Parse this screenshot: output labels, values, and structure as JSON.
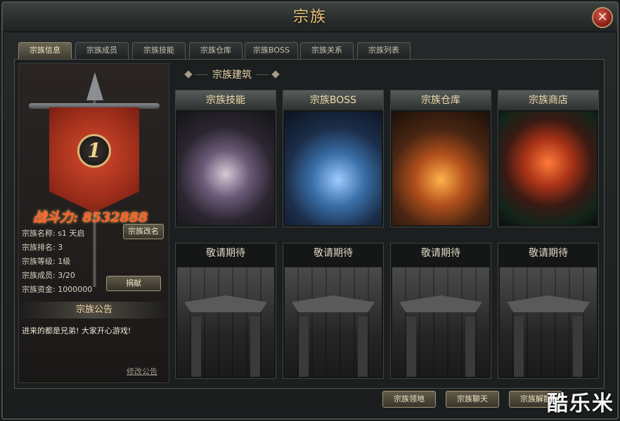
{
  "window": {
    "title": "宗族",
    "close_symbol": "✕"
  },
  "tabs": [
    {
      "label": "宗族信息",
      "active": true
    },
    {
      "label": "宗族成员"
    },
    {
      "label": "宗族技能"
    },
    {
      "label": "宗族仓库"
    },
    {
      "label": "宗族BOSS"
    },
    {
      "label": "宗族关系"
    },
    {
      "label": "宗族列表"
    }
  ],
  "clan": {
    "rank_number": "1",
    "power": "战斗力: 8532888",
    "name": "宗族名称: s1 天启",
    "rank": "宗族排名: 3",
    "level": "宗族等级: 1级",
    "members": "宗族成员: 3/20",
    "funds": "宗族资金: 1000000",
    "rename_button": "宗族改名",
    "donate_button": "捐献"
  },
  "notice": {
    "title": "宗族公告",
    "text": "进来的都是兄弟! 大家开心游戏!",
    "edit_link": "修改公告"
  },
  "buildings": {
    "header": "宗族建筑",
    "top": [
      {
        "label": "宗族技能"
      },
      {
        "label": "宗族BOSS"
      },
      {
        "label": "宗族仓库"
      },
      {
        "label": "宗族商店"
      }
    ],
    "bottom": [
      {
        "label": "敬请期待"
      },
      {
        "label": "敬请期待"
      },
      {
        "label": "敬请期待"
      },
      {
        "label": "敬请期待"
      }
    ]
  },
  "bottom_buttons": [
    "宗族领地",
    "宗族聊天",
    "宗族解散"
  ],
  "watermark": "酷乐米",
  "colors": {
    "accent_gold": "#e9c27a",
    "power_red": "#ff5a2a",
    "close_red": "#8c1f18"
  }
}
